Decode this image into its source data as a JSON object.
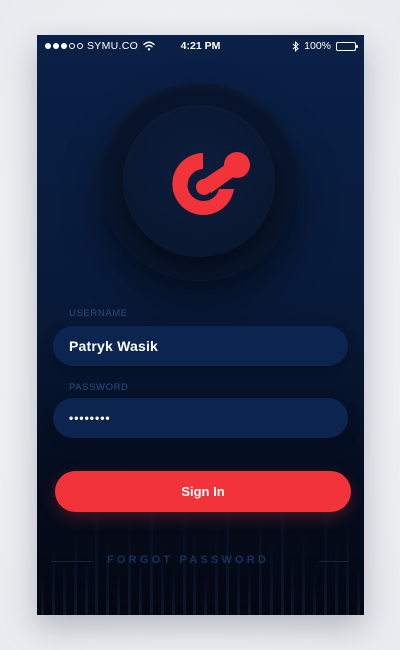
{
  "status_bar": {
    "carrier": "SYMU.CO",
    "time": "4:21 PM",
    "battery": "100%",
    "signal_strength": "3 of 5"
  },
  "logo": {
    "icon": "brand-logo-icon",
    "color": "#f2343a"
  },
  "form": {
    "username_label": "USERNAME",
    "username_value": "Patryk Wasik",
    "password_label": "PASSWORD",
    "password_value": "••••••••"
  },
  "actions": {
    "sign_in_label": "Sign In",
    "forgot_password_label": "FORGOT PASSWORD"
  },
  "colors": {
    "accent": "#f2343a",
    "background_top": "#0a2046",
    "background_bottom": "#030711",
    "input_background": "#0c2550",
    "label": "#2c4a7e"
  }
}
